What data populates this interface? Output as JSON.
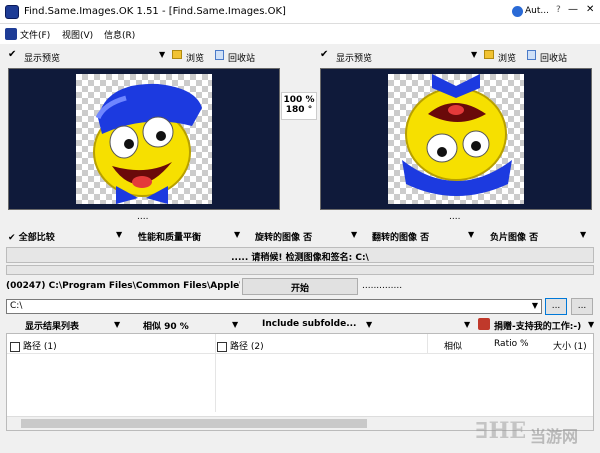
{
  "window": {
    "title": "Find.Same.Images.OK 1.51 - [Find.Same.Images.OK]",
    "user_label": "Aut...",
    "min": "—",
    "max": "☐",
    "close": "✕",
    "help": "?"
  },
  "menu": {
    "file": "文件(F)",
    "view": "视图(V)",
    "info": "信息(R)"
  },
  "left_panel": {
    "preview_label": "显示预览",
    "browse_label": "浏览",
    "recycle_label": "回收站",
    "dots": "...."
  },
  "right_panel": {
    "preview_label": "显示预览",
    "browse_label": "浏览",
    "recycle_label": "回收站",
    "dots": "...."
  },
  "center": {
    "zoom": "100 %",
    "angle": "180 °"
  },
  "options": {
    "compare_all": "全部比较",
    "balance": "性能和质量平衡",
    "rotated": "旋转的图像  否",
    "flipped": "翻转的图像  否",
    "negative": "负片图像  否"
  },
  "status": {
    "message": "..... 请稍候!   检测图像和签名: C:\\",
    "scan_path": "(00247) C:\\Program Files\\Common Files\\Apple\\A",
    "start_button": "开始",
    "dots_field": ".............."
  },
  "path": {
    "value": "C:\\",
    "browse_button": "...",
    "extra_button": "..."
  },
  "list_toolbar": {
    "show_results": "显示结果列表",
    "similarity": "相似  90 %",
    "subfolders": "Include subfolde...",
    "donate": "捐赠-支持我的工作:-)"
  },
  "table": {
    "headers": [
      "路径 (1)",
      "路径 (2)",
      "相似",
      "Ratio %",
      "大小 (1)"
    ]
  },
  "watermark": {
    "brand": "当游网"
  },
  "colors": {
    "panel_bg": "#0f1a3a",
    "accent": "#1a64c8"
  }
}
